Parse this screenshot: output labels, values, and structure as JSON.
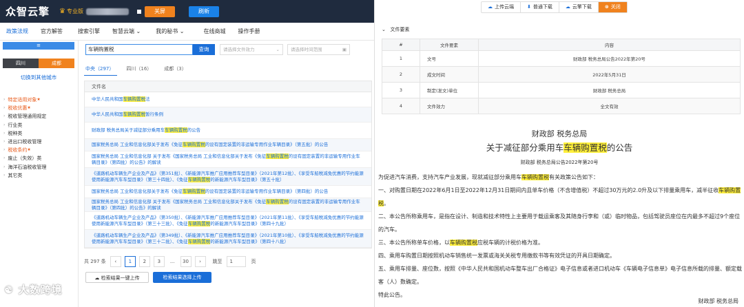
{
  "header": {
    "logo": "众智云擎",
    "pro_label": "专业版",
    "btn_shouzhan": "关屏",
    "btn_refresh": "刷新"
  },
  "nav": [
    "政策法规",
    "官方解答",
    "搜索引擎",
    "智慧云端 ⌄",
    "我的秘书 ⌄",
    "在线商城",
    "操作手册"
  ],
  "sidebar": {
    "header": "≡",
    "city1": "四川",
    "city2": "成都",
    "switch": "切换到其他城市",
    "cats": [
      {
        "t": "特定适用对象",
        "red": true,
        "star": true
      },
      {
        "t": "税收优惠",
        "red": true,
        "star": true
      },
      {
        "t": "税收管理通用规定"
      },
      {
        "t": "行业类"
      },
      {
        "t": "税种类"
      },
      {
        "t": "进出口税收管理"
      },
      {
        "t": "税收条约",
        "red": true,
        "star": true
      },
      {
        "t": "废止（失效）类"
      },
      {
        "t": "海洋石油税收管理"
      },
      {
        "t": "其它类"
      }
    ]
  },
  "search": {
    "query": "车辆购置税",
    "btn": "查询",
    "filter1": "请选择文件效力",
    "filter2": "请选择时间范围"
  },
  "tabs": [
    "中央（297）",
    "四川（16）",
    "成都（3）"
  ],
  "table": {
    "header": "文件名",
    "rows": [
      [
        "中华人民共和国",
        "车辆购置税",
        "法"
      ],
      [
        "中华人民共和国",
        "车辆购置税",
        "暂行条例"
      ],
      [
        "财政部 税务总局关于减征部分乘用车",
        "车辆购置税",
        "的公告"
      ],
      [
        "国家税务总局 工业和信息化部关于发布《免征",
        "车辆购置税",
        "的设有固定装置的非运输专用作业车辆目录》（第五批）的公告"
      ],
      [
        "国家税务总局 工业和信息化部关于发布《免征",
        "车辆购置税",
        "的设有固定装置的非运输专用作业车辆目录》（第四批）的公告"
      ],
      [
        "国家税务总局 工业和信息化部关于发布《免征",
        "车辆购置税",
        "的设有固定装置的非运输专用作业车辆目录》（第三批）的公告"
      ],
      [
        "国家税务总局 工业和信息化部关于发布《免征",
        "车辆购置税",
        "的设有固定装置的非运输专用作业车辆目录》（第二批）的公告"
      ]
    ],
    "wrapped": [
      {
        "a": "国家税务总局 工业和信息化部 关于发布《国家税务总局 工业和信息化部关于发布《免征",
        "h": "车辆购置税",
        "b": "的设有固定装置的非运输专用作业车辆目录》（第四批）的公告》的解读"
      },
      {
        "a": "《道路机动车辆生产企业及产品》（第351批）、《新能源汽车推广应用推荐车型目录》（2021年第12批）、《享受车船税减免优惠的节约能源使用新能源汽车车型目录》（第三十四批）、《免征",
        "h": "车辆购置税",
        "b": "的新能源汽车车型目录》（第五十批）"
      },
      {
        "a": "国家税务总局 工业和信息化部 关于发布《国家税务总局 工业和信息化部关于发布《免征",
        "h": "车辆购置税",
        "b": "的设有固定装置的非运输专用作业车辆目录》（第四批）的公告》的解读"
      },
      {
        "a": "《道路机动车辆生产企业及产品》（第350批）、《新能源汽车推广应用推荐车型目录》（2021年第11批）、《享受车船税减免优惠的节约能源使用新能源汽车车型目录》（第三十三批）、《免征",
        "h": "车辆购置税",
        "b": "的新能源汽车车型目录》（第四十九批）"
      },
      {
        "a": "《道路机动车辆生产企业及产品》（第349批）、《新能源汽车推广应用推荐车型目录》（2021年第10批）、《享受车船税减免优惠的节约能源 使用新能源汽车车型目录》（第三十二批）、《免征",
        "h": "车辆购置税",
        "b": "的新能源汽车车型目录》（第四十八批）"
      }
    ]
  },
  "pager": {
    "total": "共 297 条",
    "pages": [
      "1",
      "2",
      "3",
      "...",
      "30"
    ],
    "goto_label": "跳至",
    "goto_val": "1",
    "page_unit": "页",
    "prev": "‹",
    "next": "›"
  },
  "bottom": {
    "btn1": "检索结果一键上传",
    "btn2": "检索结果选择上传"
  },
  "watermark": "大数跨境",
  "right": {
    "toolbar": [
      "上传云端",
      "普通下载",
      "云擎下载",
      "关闭"
    ],
    "fy_head": "文件要素",
    "ftable": {
      "head": [
        "#",
        "文件要素",
        "内容"
      ],
      "rows": [
        [
          "1",
          "文号",
          "财政部 税务总局公告2022年第20号"
        ],
        [
          "2",
          "成文时间",
          "2022年5月31日"
        ],
        [
          "3",
          "制定(发文)单位",
          "财政部 税务总局"
        ],
        [
          "4",
          "文件效力",
          "全文有效"
        ]
      ]
    },
    "title1": "财政部 税务总局",
    "title2a": "关于减征部分乘用车",
    "title2h": "车辆购置税",
    "title2b": "的公告",
    "title3": "财政部 税务总局公告2022年第20号",
    "p1a": "为促进汽车消费，支持汽车产业发展，现就减征部分乘用车",
    "p1h": "车辆购置税",
    "p1b": "有关政策公告如下：",
    "p2a": "一、对购置日期在2022年6月1日至2022年12月31日期间内且单车价格（不含增值税）不超过30万元的2.0升及以下排量乘用车，减半征收",
    "p2h": "车辆购置税",
    "p2b": "。",
    "p3": "二、本公告所称乘用车，是指在设计、制造和技术特性上主要用于载运乘客及其随身行李和（或）临时物品，包括驾驶员座位在内最多不超过9个座位的汽车。",
    "p4a": "三、本公告所称单车价格，以",
    "p4h": "车辆购置税",
    "p4b": "应税车辆的计税价格为准。",
    "p5": "四、乘用车购置日期按照机动车销售统一发票或海关关税专用缴款书等有效凭证的开具日期确定。",
    "p6": "五、乘用车排量、座位数，按照《中华人民共和国机动车整车出厂合格证》电子信息或者进口机动车《车辆电子信息单》电子信息所载的排量、额定载客（人）数确定。",
    "p7": "特此公告。",
    "sign": "财政部  税务总局"
  }
}
